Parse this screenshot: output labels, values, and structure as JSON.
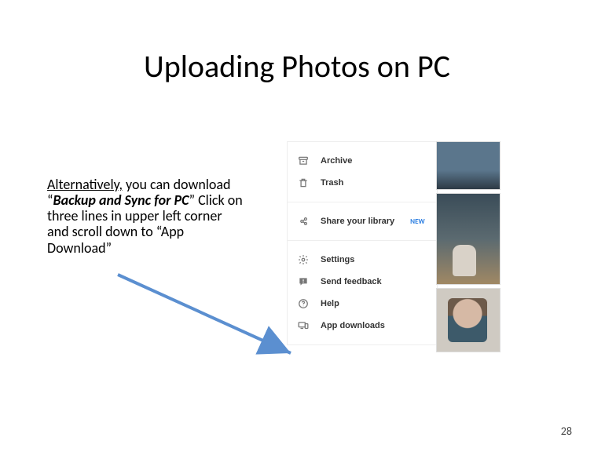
{
  "title": "Uploading Photos on PC",
  "body": {
    "prefix": "Alternatively,",
    "postPrefix": " you can download “",
    "strong": "Backup and Sync for PC",
    "suffix": "”  Click on three lines in upper left corner and scroll down to “App Download”"
  },
  "menu": {
    "group1": [
      {
        "key": "archive",
        "label": "Archive"
      },
      {
        "key": "trash",
        "label": "Trash"
      }
    ],
    "group2": [
      {
        "key": "share-library",
        "label": "Share your library",
        "badge": "NEW"
      }
    ],
    "group3": [
      {
        "key": "settings",
        "label": "Settings"
      },
      {
        "key": "send-feedback",
        "label": "Send feedback"
      },
      {
        "key": "help",
        "label": "Help"
      },
      {
        "key": "app-downloads",
        "label": "App downloads"
      }
    ]
  },
  "pageNumber": "28",
  "colors": {
    "arrow": "#5b8fd0"
  }
}
